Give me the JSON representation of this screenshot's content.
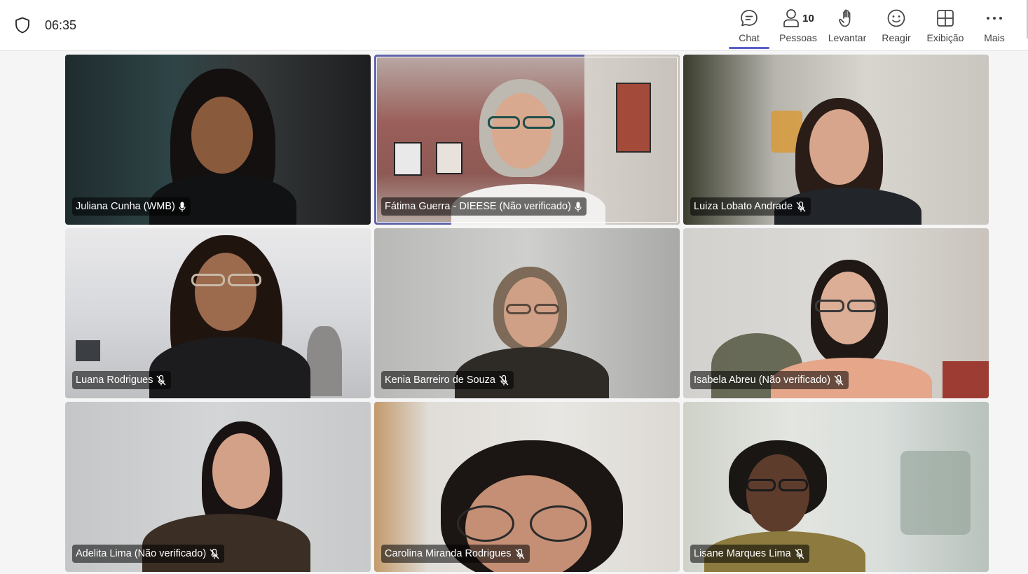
{
  "topbar": {
    "time": "06:35",
    "people_count": "10",
    "buttons": [
      {
        "label": "Chat",
        "icon": "chat-icon"
      },
      {
        "label": "Pessoas",
        "icon": "people-icon"
      },
      {
        "label": "Levantar",
        "icon": "raise-hand-icon"
      },
      {
        "label": "Reagir",
        "icon": "react-icon"
      },
      {
        "label": "Exibição",
        "icon": "view-icon"
      },
      {
        "label": "Mais",
        "icon": "more-icon"
      }
    ]
  },
  "participants": [
    {
      "name": "Juliana Cunha (WMB)",
      "mic": "on"
    },
    {
      "name": "Fátima Guerra - DIEESE (Não verificado)",
      "mic": "on"
    },
    {
      "name": "Luiza Lobato Andrade",
      "mic": "muted"
    },
    {
      "name": "Luana Rodrigues",
      "mic": "muted"
    },
    {
      "name": "Kenia Barreiro de Souza",
      "mic": "muted"
    },
    {
      "name": "Isabela Abreu (Não verificado)",
      "mic": "muted"
    },
    {
      "name": "Adelita Lima (Não verificado)",
      "mic": "muted"
    },
    {
      "name": "Carolina Miranda Rodrigues",
      "mic": "muted"
    },
    {
      "name": "Lisane Marques Lima",
      "mic": "muted"
    }
  ],
  "colors": {
    "accent": "#5b5fc7",
    "speaking_border": "#6264a7"
  }
}
